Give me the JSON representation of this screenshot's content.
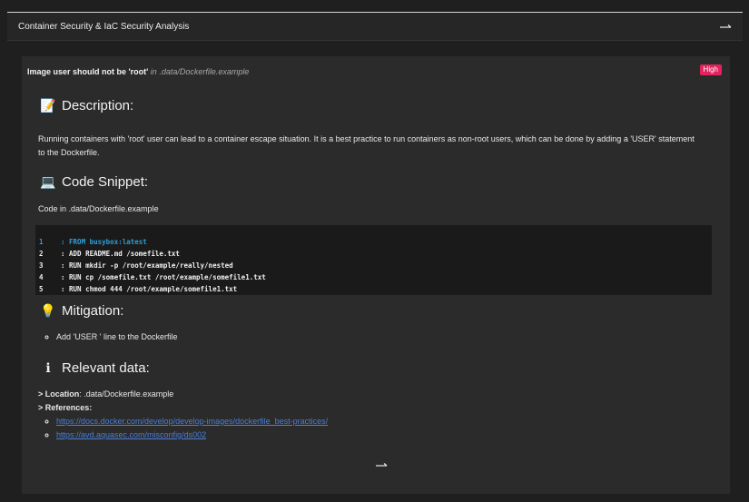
{
  "panel": {
    "title": "Container Security & IaC Security Analysis"
  },
  "issue": {
    "title": "Image user should not be 'root'",
    "in_prefix": " in ",
    "location": ".data/Dockerfile.example",
    "severity": "High",
    "severity_color": "#e0245e"
  },
  "description": {
    "icon": "memo-icon",
    "heading": "Description:",
    "text": "Running containers with 'root' user can lead to a container escape situation. It is a best practice to run containers as non-root users, which can be done by adding a 'USER' statement to the Dockerfile."
  },
  "code_snippet": {
    "icon": "laptop-icon",
    "heading": "Code Snippet:",
    "caption": "Code in .data/Dockerfile.example",
    "lines": [
      {
        "num": "1",
        "text": ": FROM busybox:latest",
        "highlight": true
      },
      {
        "num": "2",
        "text": ": ADD README.md /somefile.txt",
        "highlight": false
      },
      {
        "num": "3",
        "text": ": RUN mkdir -p /root/example/really/nested",
        "highlight": false
      },
      {
        "num": "4",
        "text": ": RUN cp /somefile.txt /root/example/somefile1.txt",
        "highlight": false
      },
      {
        "num": "5",
        "text": ": RUN chmod 444 /root/example/somefile1.txt",
        "highlight": false
      }
    ]
  },
  "mitigation": {
    "icon": "lightbulb-icon",
    "heading": "Mitigation:",
    "items": [
      "Add 'USER ' line to the Dockerfile"
    ]
  },
  "relevant": {
    "icon": "info-icon",
    "heading": "Relevant data:",
    "location_label": "> Location",
    "location_value": ": .data/Dockerfile.example",
    "references_label": "> References",
    "references_colon": ":",
    "links": [
      "https://docs.docker.com/develop/develop-images/dockerfile_best-practices/",
      "https://avd.aquasec.com/misconfig/ds002"
    ]
  },
  "colors": {
    "background": "#1f1f1f",
    "card": "#2b2b2b",
    "code_bg": "#1a1a1a",
    "link": "#4a7ed8",
    "code_highlight": "#2e9fd8"
  }
}
